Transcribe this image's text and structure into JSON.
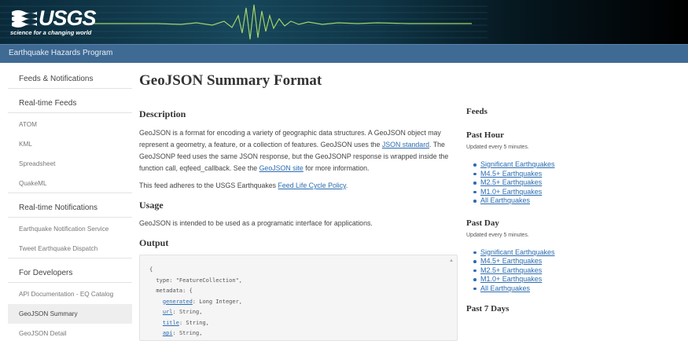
{
  "header": {
    "logo_text": "USGS",
    "tagline": "science for a changing world"
  },
  "program": {
    "name": "Earthquake Hazards Program"
  },
  "sidebar": {
    "items": [
      {
        "label": "Feeds & Notifications",
        "kind": "head"
      },
      {
        "label": "Real-time Feeds",
        "kind": "head"
      },
      {
        "label": "ATOM",
        "kind": "sub"
      },
      {
        "label": "KML",
        "kind": "sub"
      },
      {
        "label": "Spreadsheet",
        "kind": "sub"
      },
      {
        "label": "QuakeML",
        "kind": "sub"
      },
      {
        "label": "Real-time Notifications",
        "kind": "head"
      },
      {
        "label": "Earthquake Notification Service",
        "kind": "sub"
      },
      {
        "label": "Tweet Earthquake Dispatch",
        "kind": "sub"
      },
      {
        "label": "For Developers",
        "kind": "head"
      },
      {
        "label": "API Documentation - EQ Catalog",
        "kind": "sub"
      },
      {
        "label": "GeoJSON Summary",
        "kind": "sub",
        "active": true
      },
      {
        "label": "GeoJSON Detail",
        "kind": "sub"
      }
    ]
  },
  "main": {
    "title": "GeoJSON Summary Format",
    "description_heading": "Description",
    "description_p1_a": "GeoJSON is a format for encoding a variety of geographic data structures. A GeoJSON object may represent a geometry, a feature, or a collection of features. GeoJSON uses the ",
    "description_p1_link1": "JSON standard",
    "description_p1_b": ". The GeoJSONP feed uses the same JSON response, but the GeoJSONP response is wrapped inside the function call, eqfeed_callback. See the ",
    "description_p1_link2": "GeoJSON site",
    "description_p1_c": " for more information.",
    "description_p2_a": "This feed adheres to the USGS Earthquakes ",
    "description_p2_link": "Feed Life Cycle Policy",
    "description_p2_b": ".",
    "usage_heading": "Usage",
    "usage_text": "GeoJSON is intended to be used as a programatic interface for applications.",
    "output_heading": "Output",
    "code": {
      "line1": "{",
      "line2": "  type: \"FeatureCollection\",",
      "line3": "  metadata: {",
      "generated_key": "generated",
      "generated_val": ": Long Integer,",
      "url_key": "url",
      "url_val": ": String,",
      "title_key": "title",
      "title_val": ": String,",
      "api_key": "api",
      "api_val": ": String,"
    }
  },
  "feeds": {
    "title": "Feeds",
    "groups": [
      {
        "heading": "Past Hour",
        "updated": "Updated every 5 minutes.",
        "links": [
          "Significant Earthquakes",
          "M4.5+ Earthquakes",
          "M2.5+ Earthquakes",
          "M1.0+ Earthquakes",
          "All Earthquakes"
        ]
      },
      {
        "heading": "Past Day",
        "updated": "Updated every 5 minutes.",
        "links": [
          "Significant Earthquakes",
          "M4.5+ Earthquakes",
          "M2.5+ Earthquakes",
          "M1.0+ Earthquakes",
          "All Earthquakes"
        ]
      },
      {
        "heading": "Past 7 Days"
      }
    ]
  },
  "colors": {
    "program_bar": "#3f6a94",
    "link": "#2b6cb0",
    "header_bg": "#000000"
  }
}
